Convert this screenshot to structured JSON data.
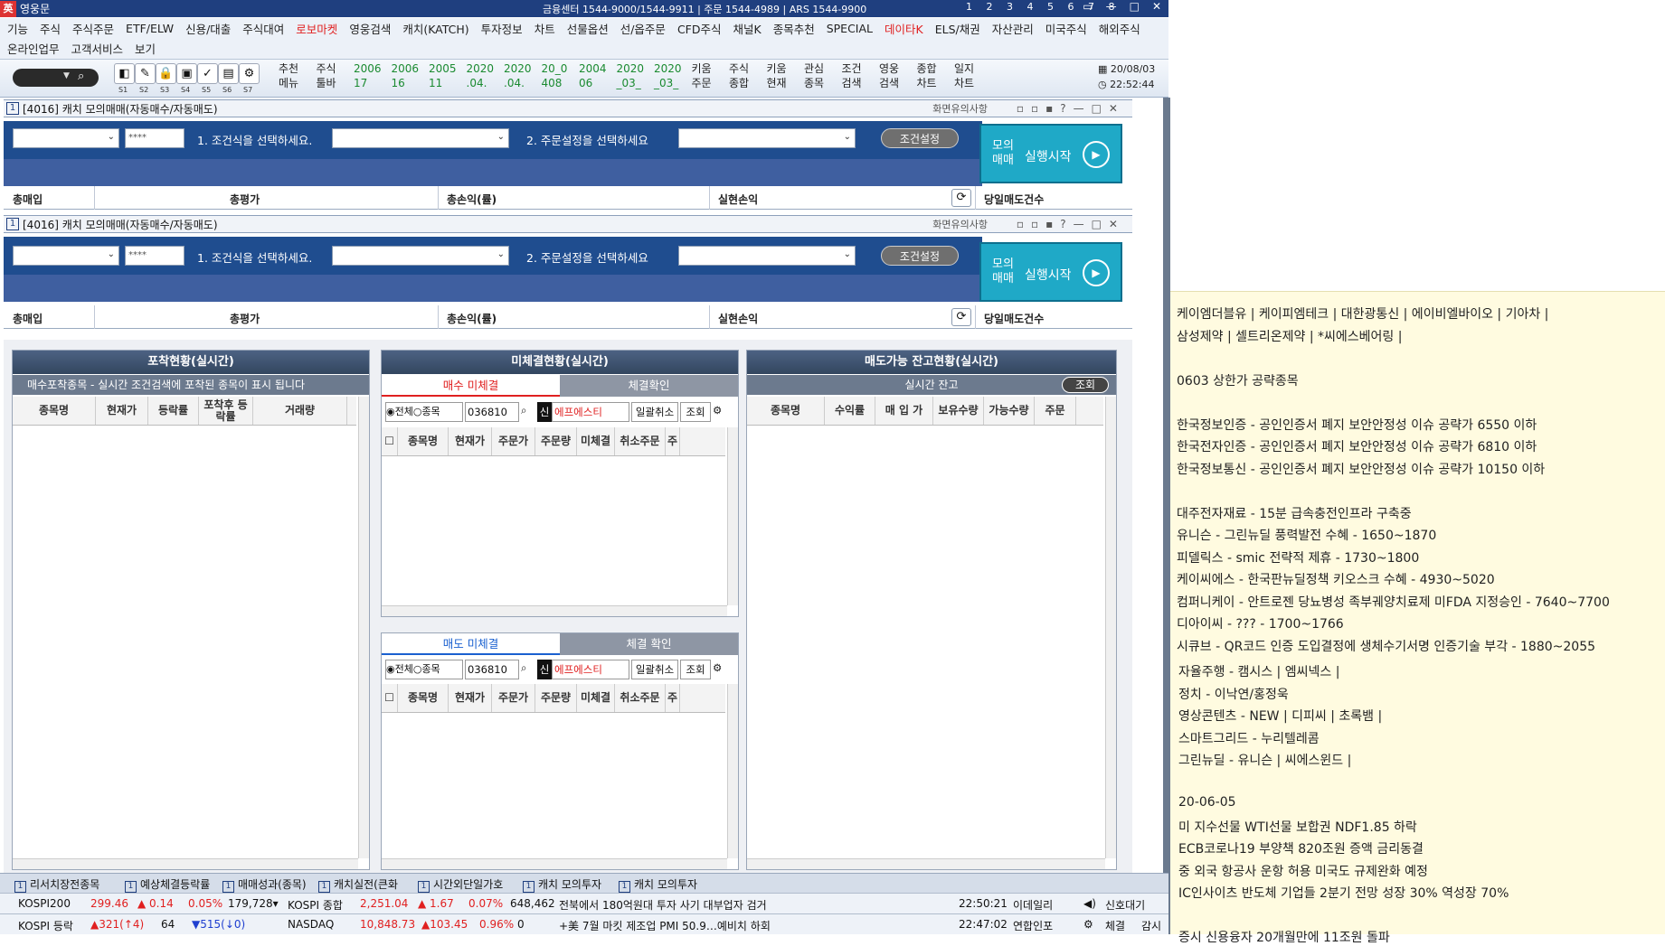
{
  "app": {
    "title": "영웅문",
    "info": "금융센터 1544-9000/1544-9911 | 주문 1544-4989 | ARS 1544-9900",
    "screen_nums": "1 2 3 4 5 6 7 8",
    "date": "20/08/03",
    "time": "22:52:44"
  },
  "menu": {
    "row1": [
      {
        "label": "기능",
        "red": false
      },
      {
        "label": "주식",
        "red": false
      },
      {
        "label": "주식주문",
        "red": false
      },
      {
        "label": "ETF/ELW",
        "red": false
      },
      {
        "label": "신용/대출",
        "red": false
      },
      {
        "label": "주식대여",
        "red": false
      },
      {
        "label": "로보마켓",
        "red": true
      },
      {
        "label": "영웅검색",
        "red": false
      },
      {
        "label": "캐치(KATCH)",
        "red": false
      },
      {
        "label": "투자정보",
        "red": false
      },
      {
        "label": "차트",
        "red": false
      },
      {
        "label": "선물옵션",
        "red": false
      },
      {
        "label": "선/옵주문",
        "red": false
      },
      {
        "label": "CFD주식",
        "red": false
      },
      {
        "label": "채널K",
        "red": false
      },
      {
        "label": "종목추천",
        "red": false
      },
      {
        "label": "SPECIAL",
        "red": false
      },
      {
        "label": "데이타K",
        "red": true
      },
      {
        "label": "ELS/채권",
        "red": false
      },
      {
        "label": "자산관리",
        "red": false
      },
      {
        "label": "미국주식",
        "red": false
      },
      {
        "label": "해외주식",
        "red": false
      }
    ],
    "row2": [
      "온라인업무",
      "고객서비스",
      "보기"
    ]
  },
  "toolbar": {
    "icon_subs": [
      "S1",
      "S2",
      "S3",
      "S4",
      "S5",
      "S6",
      "S7"
    ],
    "buttons": [
      {
        "l1": "추천",
        "l2": "메뉴",
        "green": false
      },
      {
        "l1": "주식",
        "l2": "툴바",
        "green": false
      },
      {
        "l1": "2006",
        "l2": "17",
        "green": true
      },
      {
        "l1": "2006",
        "l2": "16",
        "green": true
      },
      {
        "l1": "2005",
        "l2": "11",
        "green": true
      },
      {
        "l1": "2020",
        "l2": ".04.",
        "green": true
      },
      {
        "l1": "2020",
        "l2": ".04.",
        "green": true
      },
      {
        "l1": "20_0",
        "l2": "408",
        "green": true
      },
      {
        "l1": "2004",
        "l2": "06",
        "green": true
      },
      {
        "l1": "2020",
        "l2": "_03_",
        "green": true
      },
      {
        "l1": "2020",
        "l2": "_03_",
        "green": true
      },
      {
        "l1": "키움",
        "l2": "주문",
        "green": false
      },
      {
        "l1": "주식",
        "l2": "종합",
        "green": false
      },
      {
        "l1": "키움",
        "l2": "현재",
        "green": false
      },
      {
        "l1": "관심",
        "l2": "종목",
        "green": false
      },
      {
        "l1": "조건",
        "l2": "검색",
        "green": false
      },
      {
        "l1": "영웅",
        "l2": "검색",
        "green": false
      },
      {
        "l1": "종합",
        "l2": "차트",
        "green": false
      },
      {
        "l1": "일지",
        "l2": "차트",
        "green": false
      }
    ]
  },
  "window": {
    "title": "[4016] 캐치 모의매매(자동매수/자동매도)",
    "note": "화면유의사항",
    "password_mask": "****",
    "step1": "1. 조건식을 선택하세요.",
    "step2": "2. 주문설정을 선택하세요",
    "cond_btn": "조건설정",
    "mock_l1": "모의",
    "mock_l2": "매매",
    "mock_run": "실행시작",
    "sum_labels": [
      "총매입",
      "총평가",
      "총손익(률)",
      "실현손익",
      "당일매도건수"
    ]
  },
  "capture": {
    "title": "포착현황(실시간)",
    "subtitle": "매수포착종목 - 실시간 조건검색에 포착된 종목이 표시 됩니다",
    "cols": [
      "종목명",
      "현재가",
      "등락률",
      "포착후 등락률",
      "거래량"
    ]
  },
  "unsettled": {
    "title": "미체결현황(실시간)",
    "buy_tabs": [
      "매수 미체결",
      "체결확인"
    ],
    "sell_tabs": [
      "매도 미체결",
      "체결 확인"
    ],
    "radio_all": "◉전체",
    "radio_item": "○종목",
    "code": "036810",
    "sin": "신",
    "stock": "에프에스티",
    "cancel_all": "일괄취소",
    "query": "조회",
    "cols": [
      "종목명",
      "현재가",
      "주문가",
      "주문량",
      "미체결",
      "취소주문",
      "주"
    ]
  },
  "sellable": {
    "title": "매도가능 잔고현황(실시간)",
    "sub": "실시간 잔고",
    "query": "조회",
    "cols": [
      "종목명",
      "수익률",
      "매 입 가",
      "보유수량",
      "가능수량",
      "주문"
    ]
  },
  "taskbar": {
    "tasks": [
      "리서치장전종목",
      "예상체결등락률",
      "매매성과(종목)",
      "캐치실전(큰화",
      "시간외단일가호",
      "캐치 모의투자",
      "캐치 모의투자"
    ]
  },
  "ticker1": {
    "name": "KOSPI200",
    "val": "299.46",
    "chg": "▲ 0.14",
    "pct": "0.05%",
    "vol": "179,728▾",
    "name2": "KOSPI 종합",
    "val2": "2,251.04",
    "chg2": "▲ 1.67",
    "pct2": "0.07%",
    "vol2": "648,462",
    "news": "전북에서 180억원대 투자 사기 대부업자 검거",
    "time": "22:50:21",
    "src": "이데일리",
    "signal": "신호대기"
  },
  "ticker2": {
    "name": "KOSPI 등락",
    "up": "▲321(↑4)",
    "flat": "64",
    "down": "▼515(↓0)",
    "name2": "NASDAQ",
    "val2": "10,848.73",
    "chg2": "▲103.45",
    "pct2": "0.96%",
    "zero": "0",
    "news": "+美 7월 마킷 제조업 PMI 50.9…예비치 하회",
    "time": "22:47:02",
    "src": "연합인포",
    "b1": "체결",
    "b2": "감시"
  },
  "notes": {
    "lines_top": [
      "케이엠더블유  |  케이피엠테크  |  대한광통신  |  에이비엘바이오  |  기아차  |",
      "삼성제약  |  셀트리온제약  |  *씨에스베어링  |",
      "",
      "0603 상한가 공략종목",
      "",
      "한국정보인증 - 공인인증서 폐지 보안안정성 이슈 공략가 6550 이하",
      "한국전자인증 - 공인인증서 폐지 보안안정성 이슈 공략가 6810 이하",
      "한국정보통신 - 공인인증서 폐지 보안안정성 이슈 공략가 10150 이하",
      "",
      "대주전자재료 - 15분 급속충전인프라 구축중",
      "유니슨 - 그린뉴딜 풍력발전 수혜 - 1650~1870",
      "피델릭스 - smic 전략적 제휴 - 1730~1800",
      "케이씨에스 - 한국판뉴딜정책 키오스크 수혜 - 4930~5020",
      "컴퍼니케이 - 안트로젠 당뇨병성 족부궤양치료제 미FDA 지정승인 - 7640~7700",
      "디아이씨 - ??? - 1700~1766",
      "시큐브 - QR코드 인증 도입결정에 생체수기서명 인증기술 부각 - 1880~2055"
    ],
    "lines_bottom": [
      "자율주행 - 캠시스 | 엠씨넥스 |",
      "정치 - 이낙연/홍정욱",
      "영상콘텐츠 - NEW | 디피씨 | 초록뱀 |",
      "스마트그리드 - 누리텔레콤",
      "그린뉴딜 - 유니슨  |  씨에스윈드  |",
      "",
      "20-06-05",
      "미 지수선물 WTI선물 보합권 NDF1.85 하락",
      "ECB코로나19 부양책 820조원 증액 금리동결",
      "중 외국 항공사 운항 허용 미국도 규제완화 예정",
      "IC인사이츠 반도체 기업들 2분기 전망 성장 30% 역성장 70%",
      "",
      "증시 신용융자 20개월만에 11조원 돌파"
    ]
  }
}
